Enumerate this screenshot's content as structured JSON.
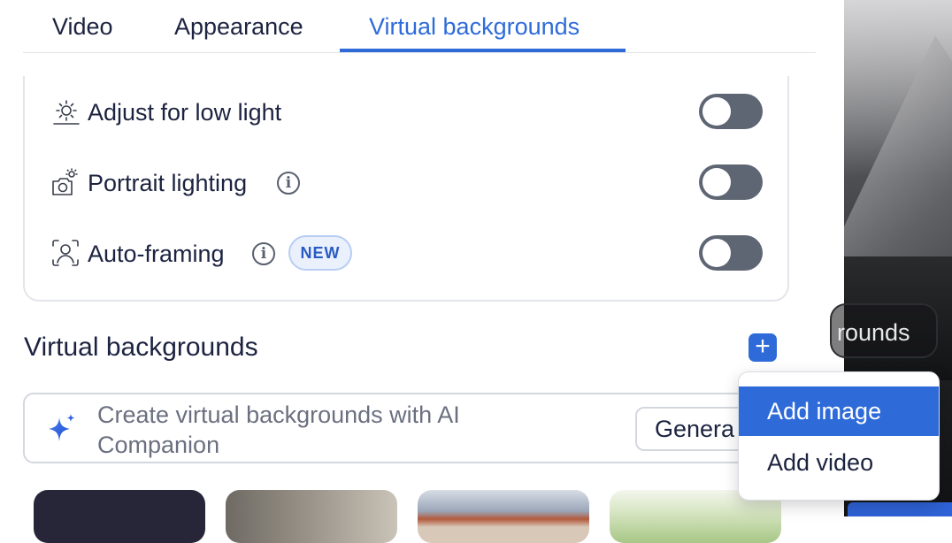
{
  "colors": {
    "accent": "#2e6bd9",
    "toggle_off": "#5f6673",
    "badge_text": "#2a5bc4"
  },
  "tabs": [
    {
      "label": "Video",
      "active": false
    },
    {
      "label": "Appearance",
      "active": false
    },
    {
      "label": "Virtual backgrounds",
      "active": true
    }
  ],
  "settings": [
    {
      "label": "Adjust for low light",
      "icon": "low-light-icon",
      "enabled": false
    },
    {
      "label": "Portrait lighting",
      "icon": "portrait-lighting-icon",
      "info": true,
      "enabled": false
    },
    {
      "label": "Auto-framing",
      "icon": "auto-framing-icon",
      "info": true,
      "badge": "NEW",
      "enabled": false
    }
  ],
  "section": {
    "title": "Virtual backgrounds",
    "add_icon": "plus-icon"
  },
  "ai_banner": {
    "text": "Create virtual backgrounds with AI Companion",
    "icon": "sparkle-icon",
    "button": "Genera"
  },
  "menu": {
    "items": [
      "Add image",
      "Add video"
    ],
    "highlighted": "Add image"
  },
  "preview": {
    "overlay_text": "rounds"
  }
}
